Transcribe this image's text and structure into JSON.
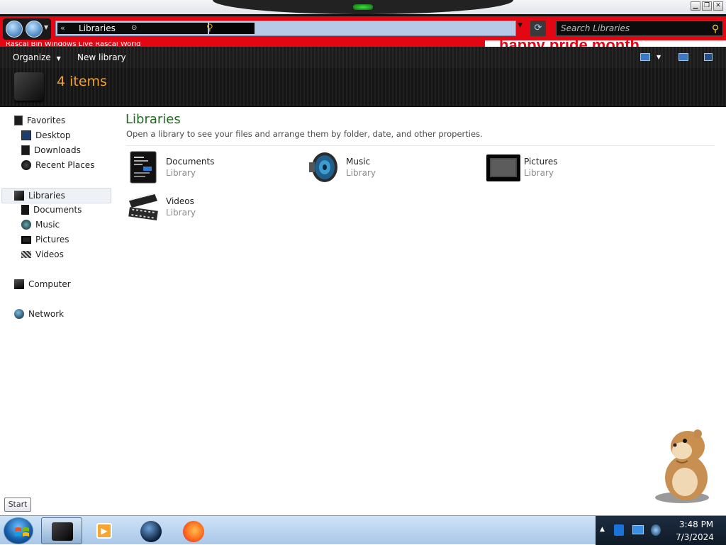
{
  "window": {
    "controls": {
      "minimize": "▁",
      "maximize": "❐",
      "close": "✕"
    }
  },
  "address_bar": {
    "path_text": "Libraries",
    "path_prefix_glyph": "«",
    "lower_strip_text": "Rascal Bin Windows Live Rascal World",
    "search_placeholder": "Search Libraries",
    "banner_text": "happy pride month"
  },
  "command_bar": {
    "organize_label": "Organize",
    "new_library_label": "New library"
  },
  "details": {
    "item_count": "4 items"
  },
  "nav_pane": {
    "favorites": {
      "label": "Favorites",
      "items": [
        {
          "label": "Desktop"
        },
        {
          "label": "Downloads"
        },
        {
          "label": "Recent Places"
        }
      ]
    },
    "libraries": {
      "label": "Libraries",
      "items": [
        {
          "label": "Documents"
        },
        {
          "label": "Music"
        },
        {
          "label": "Pictures"
        },
        {
          "label": "Videos"
        }
      ]
    },
    "computer_label": "Computer",
    "network_label": "Network"
  },
  "content": {
    "title": "Libraries",
    "subtitle": "Open a library to see your files and arrange them by folder, date, and other properties.",
    "libraries": [
      {
        "name": "Documents",
        "type": "Library",
        "icon": "documents-icon"
      },
      {
        "name": "Music",
        "type": "Library",
        "icon": "music-speaker-icon"
      },
      {
        "name": "Pictures",
        "type": "Library",
        "icon": "picture-frame-icon"
      },
      {
        "name": "Videos",
        "type": "Library",
        "icon": "film-reel-icon"
      }
    ]
  },
  "tooltip": {
    "start": "Start"
  },
  "taskbar": {
    "clock_time": "3:48 PM",
    "clock_date": "7/3/2024",
    "pinned": [
      "explorer",
      "media-player",
      "globe",
      "firefox"
    ]
  },
  "colors": {
    "address_bar_bg": "#e30613",
    "title_green": "#1e6b1e",
    "item_count_orange": "#f0a030",
    "taskbar_bg": "#b5cfec"
  }
}
